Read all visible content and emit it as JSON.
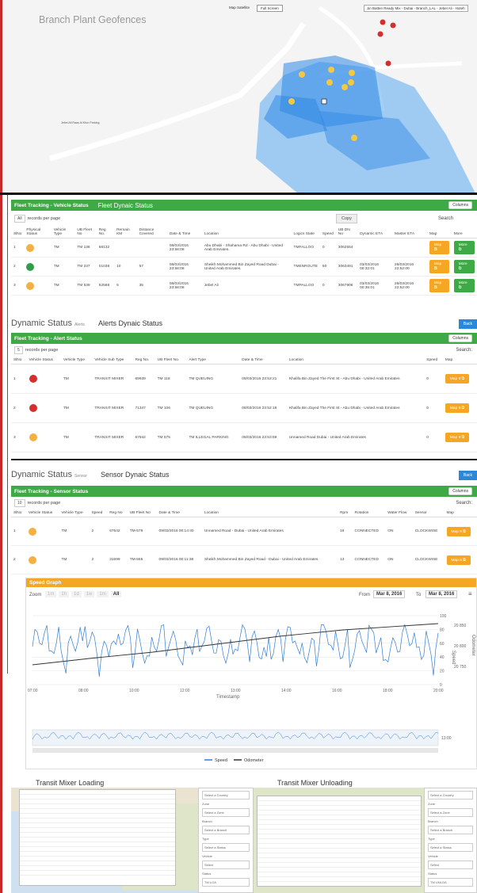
{
  "map": {
    "title": "Branch Plant Geofences",
    "map_btn": "Map",
    "satellite_btn": "Satellite",
    "fullscreen_btn": "Full Screen",
    "path": "Jin Batten Ready Mix - Dubai - Branch_LAL - Jebel Ali - Hoteh",
    "left_road_label": "Jebel Ali Raas Al Khor Parking"
  },
  "vehicle": {
    "header": "Fleet Tracking - Vehicle Status",
    "subtitle": "Fleet Dynaic Status",
    "columns_btn": "Columns",
    "records_sel": "All",
    "records_label": "records per page",
    "copy_btn": "Copy",
    "search_label": "Search",
    "headers": [
      "SlNo",
      "Physical Status",
      "Vehicle Type",
      "UB Fleet No",
      "Reg No.",
      "Remain KM",
      "Distance Covered",
      "Date & Time",
      "Location",
      "Logics State",
      "Speed",
      "UB DN No",
      "Dynamic ETA",
      "Master ETA",
      "Map",
      "More"
    ],
    "rows": [
      {
        "sl": "1",
        "icon": "y",
        "type": "TM",
        "fleet": "TM 136",
        "reg": "68132",
        "remain": "",
        "dist": "",
        "date": "08/03/2016 23:58:08",
        "loc": "Abu Dhabi - Shahama Rd - Abu Dhabi - United Arab Emirates.",
        "state": "TMFALLOO",
        "speed": "0",
        "dn": "3062554",
        "deta": "",
        "meta": ""
      },
      {
        "sl": "2",
        "icon": "g",
        "type": "TM",
        "fleet": "TM 237",
        "reg": "01038",
        "remain": "10",
        "dist": "57",
        "date": "08/03/2016 23:58:08",
        "loc": "Sheikh Mohammed Bin Zayed Road Dubai - United Arab Emirates.",
        "state": "TMENROUTE",
        "speed": "50",
        "dn": "3063491",
        "deta": "03/03/2016 00:32:01",
        "meta": "28/03/2016 22:52:00"
      },
      {
        "sl": "3",
        "icon": "y",
        "type": "TM",
        "fleet": "TM 539",
        "reg": "52568",
        "remain": "5",
        "dist": "35",
        "date": "08/03/2016 23:58:08",
        "loc": "Jebel Ali",
        "state": "TMPALLOO",
        "speed": "0",
        "dn": "3067906",
        "deta": "03/03/2016 00:35:01",
        "meta": "28/03/2016 22:52:00"
      }
    ],
    "map_btn": "Map",
    "more_btn": "More"
  },
  "alerts_section": {
    "title": "Dynamic Status",
    "small": "Alerts",
    "sub": "Alerts Dynaic Status",
    "back_btn": "Back"
  },
  "alert": {
    "header": "Fleet Tracking - Alert Status",
    "columns_btn": "Columns",
    "records_sel": "5",
    "records_label": "records per page",
    "search_label": "Search:",
    "headers": [
      "SlNo",
      "Vehicle Status",
      "Vehicle Type",
      "Vehicle Sub Type",
      "Reg No.",
      "UB Fleet No.",
      "Alert Type",
      "Date & Time",
      "Location",
      "Speed",
      "Map"
    ],
    "rows": [
      {
        "sl": "1",
        "icon": "r",
        "type": "TM",
        "sub": "TRANSIT MIXER",
        "reg": "69939",
        "fleet": "TM 118",
        "alert": "TM QUEUING",
        "date": "08/03/2016 23:53:21",
        "loc": "Khalifa Bin Zayed The First St - Abu Dhabi - United Arab Emirates",
        "speed": "0"
      },
      {
        "sl": "2",
        "icon": "r",
        "type": "TM",
        "sub": "TRANSIT MIXER",
        "reg": "71347",
        "fleet": "TM 106",
        "alert": "TM QUEUING",
        "date": "08/03/2016 23:52:18",
        "loc": "Khalifa Bin Zayed The First St - Abu Dhabi - United Arab Emirates",
        "speed": "0"
      },
      {
        "sl": "3",
        "icon": "y",
        "type": "TM",
        "sub": "TRANSIT MIXER",
        "reg": "67942",
        "fleet": "TM 575",
        "alert": "TM ILLEGAL PARKING",
        "date": "08/03/2016 23:53:59",
        "loc": "Unnamed Road Dubai - United Arab Emirates",
        "speed": "0"
      }
    ],
    "map_btn": "Map It"
  },
  "sensor_section": {
    "title": "Dynamic Status",
    "small": "Sensor",
    "sub": "Sensor Dynaic Status",
    "back_btn": "Back"
  },
  "sensor": {
    "header": "Fleet Tracking - Sensor Status",
    "columns_btn": "Columns",
    "records_sel": "10",
    "records_label": "records per page",
    "search_label": "Search:",
    "headers": [
      "SlNo",
      "Vehicle Status",
      "Vehicle Type",
      "Speed",
      "Reg No",
      "UB Fleet No",
      "Date & Time",
      "Location",
      "Rpm",
      "Rotation",
      "Water Flow",
      "Sensor",
      "Map"
    ],
    "rows": [
      {
        "sl": "1",
        "icon": "y",
        "type": "TM",
        "speed": "2",
        "reg": "67542",
        "fleet": "TM-579",
        "date": "09/03/2016 00:14:40",
        "loc": "Unnamed Road - Dubai - United Arab Emirates",
        "rpm": "16",
        "rot": "CONNECTED",
        "water": "ON",
        "sensor": "CLOCKWISE"
      },
      {
        "sl": "2",
        "icon": "y",
        "type": "TM",
        "speed": "2",
        "reg": "31599",
        "fleet": "TM-555",
        "date": "09/03/2016 00:11:38",
        "loc": "Sheikh Mohammed Bin Zayed Road - Dubai - United Arab Emirates",
        "rpm": "13",
        "rot": "CONNECTED",
        "water": "ON",
        "sensor": "CLOCKWISE"
      },
      {
        "sl": "3",
        "icon": "gr",
        "type": "TM",
        "speed": "11",
        "reg": "62192",
        "fleet": "TM-543",
        "date": "08/03/2016 15:41:26",
        "loc": "Sheikh Mohammed Bin Zayed Road - Dubai - United",
        "rpm": "11",
        "rot": "CONNECTED",
        "water": "OFF",
        "sensor": "CLOCKWISE"
      }
    ],
    "map_btn": "Map It"
  },
  "speed_graph": {
    "header": "Speed Graph",
    "zoom_label": "Zoom",
    "zoom_opts": [
      "1m",
      "1h",
      "1d",
      "1w",
      "1m",
      "All"
    ],
    "from_label": "From",
    "from_val": "Mar 8, 2016",
    "to_label": "To",
    "to_val": "Mar 8, 2016",
    "x_title": "Timestamp",
    "x_ticks": [
      "07:00",
      "08:00",
      "10:00",
      "12:00",
      "13:00",
      "14:00",
      "16:00",
      "18:00",
      "20:00"
    ],
    "speed_axis_label": "Speed",
    "speed_ticks": [
      "100",
      "80",
      "60",
      "40",
      "20",
      "0"
    ],
    "odo_axis_label": "Odometer",
    "odo_ticks": [
      "20 850",
      "20 800",
      "20 750"
    ],
    "nav_label": "13:00",
    "legend_speed": "Speed",
    "legend_odo": "Odometer",
    "speed_color": "#2f7ed8",
    "odo_color": "#333333"
  },
  "loading": {
    "title": "Transit Mixer Loading",
    "side_fields": [
      "Select a Country",
      "Zone",
      "Select a Zone",
      "Branch",
      "Select a Branch",
      "Type",
      "Select a Status",
      "Vehicle",
      "Select",
      "Status",
      "TM LOA"
    ]
  },
  "unloading": {
    "title": "Transit Mixer Unloading",
    "side_fields": [
      "Select a Country",
      "Zone",
      "Select a Zone",
      "Branch",
      "Select a Branch",
      "Type",
      "Select a Status",
      "Vehicle",
      "Select",
      "Status",
      "TM UNLOA"
    ]
  }
}
